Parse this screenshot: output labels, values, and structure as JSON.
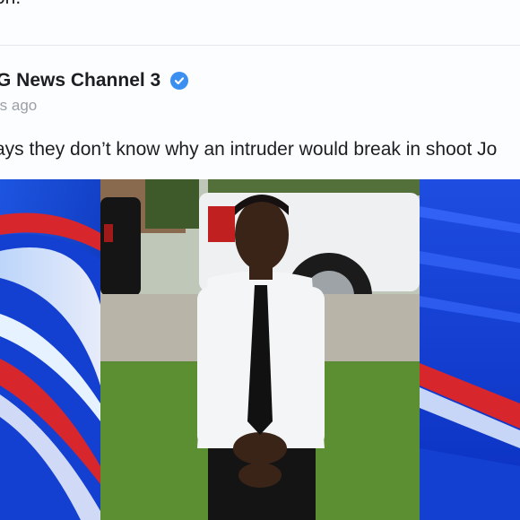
{
  "previous_post": {
    "text_fragment": "on."
  },
  "post": {
    "page_name": "G News Channel 3",
    "verified_icon": "verified-badge-icon",
    "timestamp": "rs ago",
    "text": "ays they don’t know why an intruder would break in shoot Jo"
  },
  "colors": {
    "background": "#fbfdfe",
    "verified": "#3b8ff0",
    "broadcast_blue": "#0b38c8",
    "broadcast_red": "#d8262d"
  }
}
